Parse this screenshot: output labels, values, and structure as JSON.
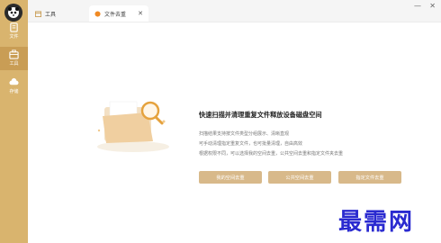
{
  "sidebar": {
    "items": [
      {
        "label": "文件",
        "icon": "document-icon"
      },
      {
        "label": "工具",
        "icon": "toolbox-icon"
      },
      {
        "label": "存储",
        "icon": "cloud-icon"
      }
    ]
  },
  "tabs": [
    {
      "label": "工具",
      "icon": "calendar-icon"
    },
    {
      "label": "文件去重",
      "icon": "orange-dot-icon",
      "close": "✕"
    }
  ],
  "window": {
    "minimize": "—",
    "close": "✕"
  },
  "main": {
    "title": "快速扫描并清理重复文件释放设备磁盘空间",
    "lines": [
      "扫描结果支持按文件类型分组展示、清晰直观",
      "可手动清理指定重复文件，也可批量清理，自由高效",
      "根据权限不同，可以选择我的空间去重，公共空间去重和指定文件夹去重"
    ],
    "buttons": [
      "我的空间去重",
      "公共空间去重",
      "指定文件去重"
    ]
  },
  "watermark": "最需网",
  "colors": {
    "sidebar": "#d9b46e",
    "button": "#d8b98a",
    "watermark": "#2a2ad0"
  }
}
